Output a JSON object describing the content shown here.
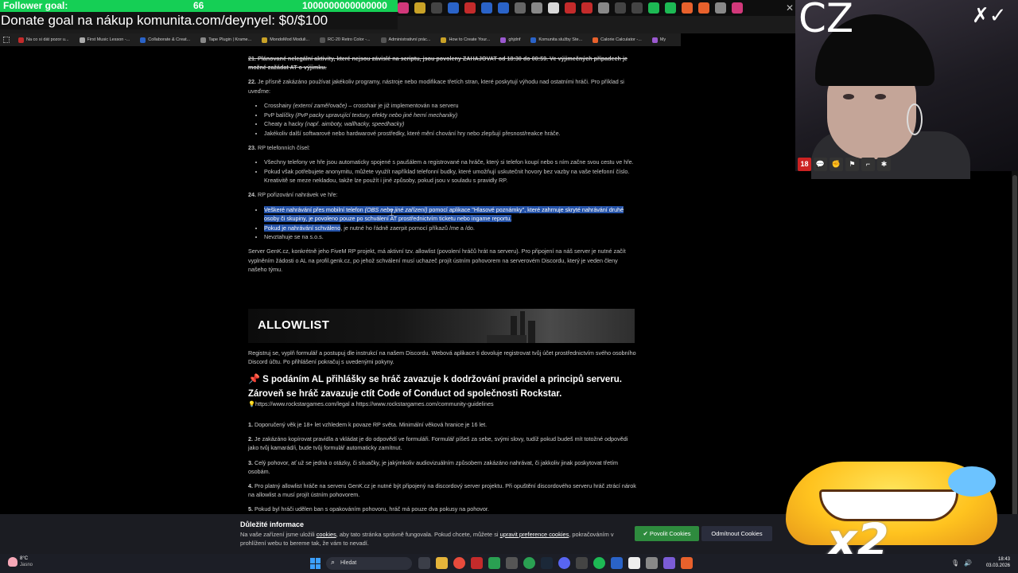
{
  "overlay": {
    "follower_label": "Follower goal:",
    "follower_current": "66",
    "follower_target": "1000000000000000",
    "donate_text": "Donate goal na nákup komunita.com/deynyel: $0/$100"
  },
  "bookmarks": [
    "Na co si dát pozor u...",
    "First Music Lesson -...",
    "Collaborate & Creat...",
    "Tape Plugin | Krame...",
    "MondoMod Moduli...",
    "RC-20 Retro Color -...",
    "Administrativní prác...",
    "How to Create Your...",
    "ghjdnf",
    "Komunita služby Ste...",
    "Calorie Calculator -...",
    "My"
  ],
  "content": {
    "rule21": "21. Plánované nelegální aktivity, které nejsou závislé na scriptu, jsou povoleny ZAHAJOVAT od 18:30 do 00:59. Ve výjimečných případech je možné zažádat AT o výjimku.",
    "rule22_num": "22.",
    "rule22": "Je přísně zakázáno používat jakékoliv programy, nástroje nebo modifikace třetích stran, které poskytují výhodu nad ostatními hráči. Pro příklad si uveďme:",
    "rule22_items": [
      {
        "a": "Crosshairy ",
        "b": "(externí zaměřovače)",
        "c": " – crosshair je již implementován na serveru"
      },
      {
        "a": "PvP balíčky ",
        "b": "(PvP packy upravující textury, efekty nebo jiné herní mechaniky)",
        "c": ""
      },
      {
        "a": "Cheaty a hacky ",
        "b": "(např. aimboty, wallhacky, speedhacky)",
        "c": ""
      },
      {
        "a": "Jakékoliv další softwarové nebo hardwarové prostředky, které mění chování hry nebo zlepšují přesnost/reakce hráče.",
        "b": "",
        "c": ""
      }
    ],
    "rule23_num": "23.",
    "rule23": "RP telefonních čísel:",
    "rule23_items": [
      "Všechny telefony ve hře jsou automaticky spojené s paušálem a registrované na hráče, který si telefon koupí nebo s ním začne svou cestu ve hře.",
      "Pokud však potřebujete anonymitu, můžete využít například telefonní budky, které umožňují uskutečnit hovory bez vazby na vaše telefonní číslo. Kreativitě se meze nekladou, takže lze použít i jiné způsoby, pokud jsou v souladu s pravidly RP."
    ],
    "rule24_num": "24.",
    "rule24": "RP pořizování nahrávek ve hře:",
    "rule24_item1_a": "Veškeré nahrávání přes mobilní telefon ",
    "rule24_item1_b": "(OBS nebo jiné zařízení)",
    "rule24_item1_c": " pomocí aplikace \"Hlasové poznámky\", které zahrnuje skryté nahrávání druhé osoby či skupiny, je povoleno pouze po schválení AT prostřednictvím ticketu nebo ingame reportu.",
    "rule24_item2_a": "Pokud je nahrávání schváleno",
    "rule24_item2_b": ", je nutné ho řádně zaerpit pomocí příkazů /me a /do.",
    "rule24_item3": "Nevztahuje se na s.o.s.",
    "server_para": "Server GenK.cz, konkrétně jeho FiveM RP projekt, má aktivní tzv. allowlist (povolení hráčů hrát na serveru). Pro připojení na náš server je nutné začít vyplněním žádosti o AL na profil.genk.cz, po jehož schválení musí uchazeč projít ústním pohovorem na serverovém Discordu, který je veden členy našeho týmu."
  },
  "allowlist": {
    "title": "ALLOWLIST",
    "intro": "Registruj se, vyplň formulář a postupuj dle instrukcí na našem Discordu. Webová aplikace ti dovoluje registrovat tvůj účet prostřednictvím svého osobního Discord účtu. Po přihlášení pokračuj s uvedenými pokyny.",
    "pledge_icon": "📌",
    "pledge": "S podáním AL přihlášky se hráč zavazuje k dodržování pravidel a principů serveru. Zároveň se hráč zavazuje ctít Code of Conduct od společnosti Rockstar.",
    "links_icon": "💡",
    "links": "https://www.rockstargames.com/legal a https://www.rockstargames.com/community-guidelines",
    "rules": [
      {
        "n": "1.",
        "t": "Doporučený věk je 18+ let vzhledem k povaze RP světa. Minimální věková hranice je 16 let."
      },
      {
        "n": "2.",
        "t": "Je zakázáno kopírovat pravidla a vkládat je do odpovědí ve formuláři. Formulář píšeš za sebe, svými slovy, tudíž pokud budeš mít totožné odpovědi jako tvůj kamarád/i, bude tvůj formulář automaticky zamítnut."
      },
      {
        "n": "3.",
        "t": "Celý pohovor, ať už se jedná o otázky, či situačky, je jakýmkoliv audiovizuálním způsobem zakázáno nahrávat, či jakkoliv jinak poskytovat třetím osobám."
      },
      {
        "n": "4.",
        "t": "Pro platný allowlist hráče na serveru GenK.cz je nutné být připojený na discordový server projektu. Při opuštění discordového serveru hráč ztrácí nárok na allowlist a musí projít ústním pohovorem."
      },
      {
        "n": "5.",
        "t": "Pokud byl hráči udělen ban s opakováním pohovoru, hráč má pouze dva pokusy na pohovor."
      }
    ]
  },
  "cookie": {
    "title": "Důležité informace",
    "text_a": "Na vaše zařízení jsme uložili ",
    "link1": "cookies",
    "text_b": ", aby tato stránka správně fungovala. Pokud chcete, můžete si ",
    "link2": "upravit preference cookies",
    "text_c": ", pokračováním v prohlížení webu to bereme tak, že vám to nevadí.",
    "allow": "✔ Povolit Cookies",
    "deny": "Odmítnout Cookies"
  },
  "webcam": {
    "label": "CZ",
    "badge": "18"
  },
  "emoji": {
    "multiplier": "x2"
  },
  "taskbar": {
    "temp": "8°C",
    "weather": "Jasno",
    "search": "Hledat",
    "time": "18:43",
    "date": "03.03.2026"
  },
  "colors": {
    "follower_bar": "#15cf55",
    "selection": "#2452a8",
    "allow_button": "#2e8b3e",
    "deny_button": "#2a2d3c"
  }
}
